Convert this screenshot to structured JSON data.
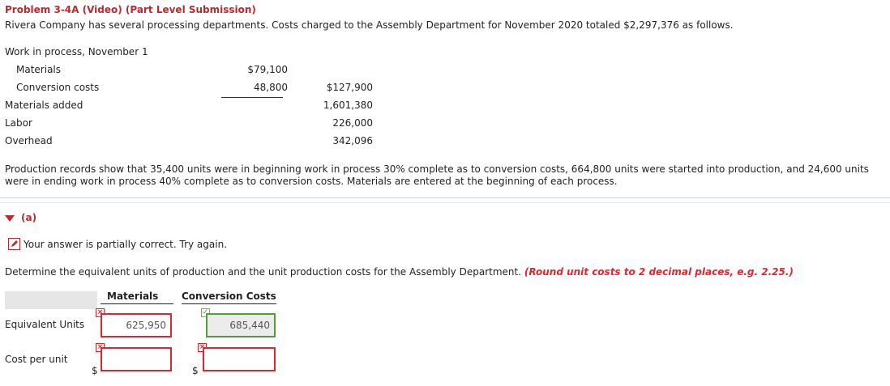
{
  "problem": {
    "title": "Problem 3-4A (Video) (Part Level Submission)",
    "intro": "Rivera Company has several processing departments. Costs charged to the Assembly Department for November 2020 totaled $2,297,376 as follows."
  },
  "costs": {
    "wip_heading": "Work in process, November 1",
    "materials_label": "Materials",
    "materials_value": "$79,100",
    "conversion_label": "Conversion costs",
    "conversion_value": "48,800",
    "wip_total": "$127,900",
    "materials_added_label": "Materials added",
    "materials_added_value": "1,601,380",
    "labor_label": "Labor",
    "labor_value": "226,000",
    "overhead_label": "Overhead",
    "overhead_value": "342,096"
  },
  "production_text": "Production records show that 35,400 units were in beginning work in process 30% complete as to conversion costs, 664,800 units were started into production, and 24,600 units were in ending work in process 40% complete as to conversion costs. Materials are entered at the beginning of each process.",
  "part": {
    "label": "(a)",
    "status": "Your answer is partially correct.  Try again.",
    "instruction": "Determine the equivalent units of production and the unit production costs for the Assembly Department. ",
    "hint": "(Round unit costs to 2 decimal places, e.g. 2.25.)"
  },
  "table": {
    "col_materials": "Materials",
    "col_conversion": "Conversion Costs",
    "row_equiv": "Equivalent Units",
    "row_cost": "Cost per unit",
    "equiv_materials": "625,950",
    "equiv_conversion": "685,440",
    "cost_materials": "",
    "cost_conversion": "",
    "dollar_sign": "$"
  },
  "colors": {
    "accent_red": "#c0282d",
    "correct_green": "#4f9d3c"
  }
}
